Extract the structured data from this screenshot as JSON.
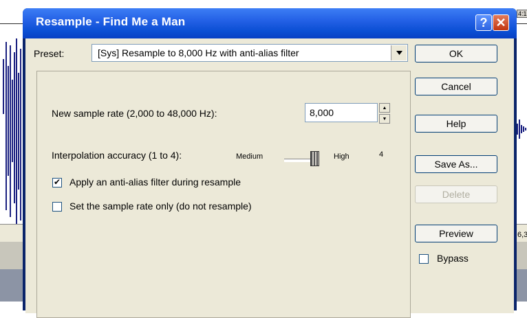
{
  "background": {
    "time_label": "4:1",
    "position_label": "6,3"
  },
  "dialog": {
    "title": "Resample - Find Me a Man",
    "help_icon_glyph": "?",
    "close_icon_glyph": "✕"
  },
  "preset": {
    "label": "Preset:",
    "value": "[Sys] Resample to  8,000 Hz with anti-alias filter"
  },
  "sample_rate": {
    "label": "New sample rate (2,000 to 48,000 Hz):",
    "value": "8,000"
  },
  "interpolation": {
    "label": "Interpolation accuracy (1 to 4):",
    "min_label": "Medium",
    "max_label": "High",
    "value": "4",
    "level_fraction": 1.0
  },
  "options": {
    "anti_alias_label": "Apply an anti-alias filter during resample",
    "anti_alias_checked": true,
    "rate_only_label": "Set the sample rate only (do not resample)",
    "rate_only_checked": false
  },
  "buttons": {
    "ok": "OK",
    "cancel": "Cancel",
    "help": "Help",
    "save_as": "Save As...",
    "delete": "Delete",
    "preview": "Preview",
    "bypass": "Bypass"
  },
  "colors": {
    "title_bar": "#2461e6",
    "dialog_face": "#ece9d8",
    "waveform": "#1a2080"
  },
  "icons": [
    "help-icon",
    "close-icon",
    "dropdown-arrow-icon",
    "spin-up-icon",
    "spin-down-icon",
    "checkmark-icon"
  ]
}
